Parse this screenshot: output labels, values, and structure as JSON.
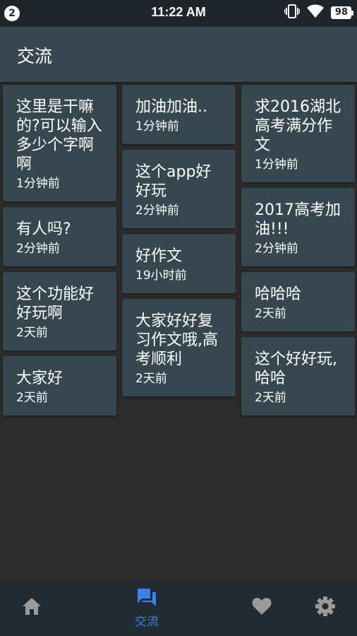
{
  "status_bar": {
    "notification_count": "2",
    "time": "11:22 AM",
    "battery_level": "98",
    "icons": [
      "vibrate-icon",
      "wifi-icon",
      "battery-icon"
    ]
  },
  "app_bar": {
    "title": "交流"
  },
  "posts": {
    "col1": [
      {
        "text": "这里是干嘛的?可以输入多少个字啊啊",
        "time": "1分钟前"
      },
      {
        "text": "有人吗?",
        "time": "2分钟前"
      },
      {
        "text": "这个功能好好玩啊",
        "time": "2天前"
      },
      {
        "text": "大家好",
        "time": "2天前"
      }
    ],
    "col2": [
      {
        "text": "加油加油..",
        "time": "1分钟前"
      },
      {
        "text": "这个app好好玩",
        "time": "2分钟前"
      },
      {
        "text": "好作文",
        "time": "19小时前"
      },
      {
        "text": "大家好好复习作文哦,高考顺利",
        "time": "2天前"
      }
    ],
    "col3": [
      {
        "text": "求2016湖北高考满分作文",
        "time": "1分钟前"
      },
      {
        "text": "2017高考加油!!!",
        "time": "2分钟前"
      },
      {
        "text": "哈哈哈",
        "time": "2天前"
      },
      {
        "text": "这个好好玩,哈哈",
        "time": "2天前"
      }
    ]
  },
  "bottom_nav": {
    "items": [
      {
        "icon": "home-icon",
        "label": ""
      },
      {
        "icon": "forum-icon",
        "label": "交流",
        "active": true
      },
      {
        "icon": "heart-icon",
        "label": ""
      },
      {
        "icon": "settings-icon",
        "label": ""
      }
    ]
  },
  "colors": {
    "app_bar": "#37474f",
    "card": "#37474f",
    "background": "#2c2c2c",
    "nav_background": "#222b31",
    "active_accent": "#3d82e8",
    "inactive_icon": "#9a9a9a"
  }
}
